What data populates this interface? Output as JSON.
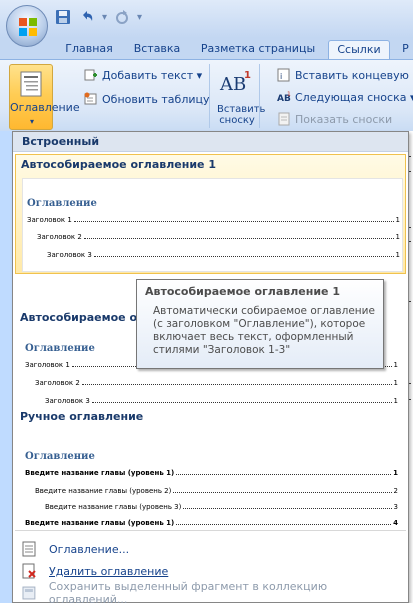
{
  "qat": {
    "redo_sep": "▾"
  },
  "tabs": [
    {
      "label": "Главная"
    },
    {
      "label": "Вставка"
    },
    {
      "label": "Разметка страницы"
    },
    {
      "label": "Ссылки"
    },
    {
      "label": "Р"
    }
  ],
  "ribbon": {
    "toc_label": "Оглавление",
    "toc_arrow": "▾",
    "add_text": "Добавить текст ▾",
    "update_table": "Обновить таблицу",
    "footnote_glyph": "AB",
    "footnote_sup": "1",
    "insert_footnote": "Вставить сноску",
    "insert_endnote": "Вставить концевую сн",
    "next_footnote": "Следующая сноска ▾",
    "show_notes": "Показать сноски"
  },
  "gallery": {
    "header": "Встроенный",
    "items": [
      {
        "title": "Автособираемое оглавление 1",
        "heading": "Оглавление",
        "lines": [
          {
            "label": "Заголовок 1",
            "page": "1"
          },
          {
            "label": "Заголовок 2",
            "page": "1"
          },
          {
            "label": "Заголовок 3",
            "page": "1"
          }
        ]
      },
      {
        "title": "Автособираемое огл",
        "heading": "Оглавление",
        "lines": [
          {
            "label": "Заголовок 1",
            "page": "1"
          },
          {
            "label": "Заголовок 2",
            "page": "1"
          },
          {
            "label": "Заголовок 3",
            "page": "1"
          }
        ]
      },
      {
        "title": "Ручное оглавление",
        "heading": "Оглавление",
        "lines": [
          {
            "label": "Введите название главы (уровень 1)",
            "page": "1"
          },
          {
            "label": "Введите название главы (уровень 2)",
            "page": "2"
          },
          {
            "label": "Введите название главы (уровень 3)",
            "page": "3"
          },
          {
            "label": "Введите название главы (уровень 1)",
            "page": "4"
          }
        ]
      }
    ]
  },
  "tooltip": {
    "title": "Автособираемое оглавление 1",
    "body": "Автоматически собираемое оглавление (с заголовком \"Оглавление\"), которое включает весь текст, оформленный стилями \"Заголовок 1-3\""
  },
  "menu": {
    "toc": "Оглавление...",
    "remove": "Удалить оглавление",
    "save_selection": "Сохранить выделенный фрагмент в коллекцию оглавлений..."
  },
  "colors": {
    "accent": "#15428b",
    "hover_bg": "#ffe9a8",
    "ribbon_bg": "#dbe7f7"
  }
}
